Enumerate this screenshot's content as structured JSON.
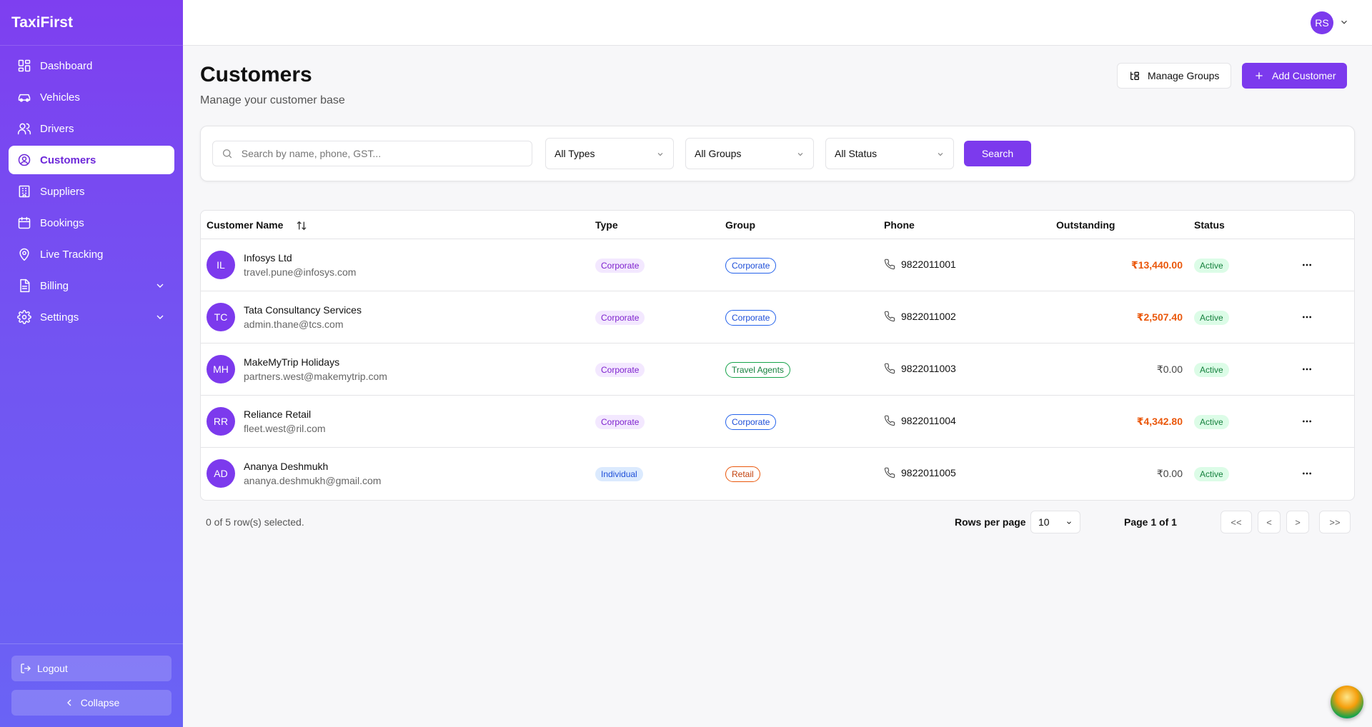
{
  "app": {
    "brand": "TaxiFirst"
  },
  "sidebar": {
    "items": [
      {
        "label": "Dashboard",
        "icon": "dashboard-icon"
      },
      {
        "label": "Vehicles",
        "icon": "car-icon"
      },
      {
        "label": "Drivers",
        "icon": "users-icon"
      },
      {
        "label": "Customers",
        "icon": "user-circle-icon",
        "active": true
      },
      {
        "label": "Suppliers",
        "icon": "building-icon"
      },
      {
        "label": "Bookings",
        "icon": "calendar-icon"
      },
      {
        "label": "Live Tracking",
        "icon": "map-pin-icon"
      },
      {
        "label": "Billing",
        "icon": "document-icon",
        "expandable": true
      },
      {
        "label": "Settings",
        "icon": "gear-icon",
        "expandable": true
      }
    ],
    "logout_label": "Logout",
    "collapse_label": "Collapse"
  },
  "topbar": {
    "avatar_initials": "RS"
  },
  "page": {
    "title": "Customers",
    "subtitle": "Manage your customer base",
    "manage_groups_label": "Manage Groups",
    "add_customer_label": "Add Customer"
  },
  "filters": {
    "search_placeholder": "Search by name, phone, GST...",
    "type_selected": "All Types",
    "group_selected": "All Groups",
    "status_selected": "All Status",
    "search_button": "Search"
  },
  "table": {
    "columns": [
      "Customer Name",
      "Type",
      "Group",
      "Phone",
      "Outstanding",
      "Status"
    ],
    "rows": [
      {
        "initials": "IL",
        "name": "Infosys Ltd",
        "email": "travel.pune@infosys.com",
        "type": "Corporate",
        "group": "Corporate",
        "phone": "9822011001",
        "outstanding": "₹13,440.00",
        "status": "Active"
      },
      {
        "initials": "TC",
        "name": "Tata Consultancy Services",
        "email": "admin.thane@tcs.com",
        "type": "Corporate",
        "group": "Corporate",
        "phone": "9822011002",
        "outstanding": "₹2,507.40",
        "status": "Active"
      },
      {
        "initials": "MH",
        "name": "MakeMyTrip Holidays",
        "email": "partners.west@makemytrip.com",
        "type": "Corporate",
        "group": "Travel Agents",
        "phone": "9822011003",
        "outstanding": "₹0.00",
        "status": "Active"
      },
      {
        "initials": "RR",
        "name": "Reliance Retail",
        "email": "fleet.west@ril.com",
        "type": "Corporate",
        "group": "Corporate",
        "phone": "9822011004",
        "outstanding": "₹4,342.80",
        "status": "Active"
      },
      {
        "initials": "AD",
        "name": "Ananya Deshmukh",
        "email": "ananya.deshmukh@gmail.com",
        "type": "Individual",
        "group": "Retail",
        "phone": "9822011005",
        "outstanding": "₹0.00",
        "status": "Active"
      }
    ]
  },
  "pagination": {
    "selection_text": "0 of 5 row(s) selected.",
    "rows_per_page_label": "Rows per page",
    "rows_per_page_value": "10",
    "page_info": "Page 1 of 1",
    "first": "<<",
    "prev": "<",
    "next": ">",
    "last": ">>"
  },
  "colors": {
    "accent": "#7c3aed",
    "outstanding_due": "#ea580c",
    "active_status": "#15803d"
  }
}
